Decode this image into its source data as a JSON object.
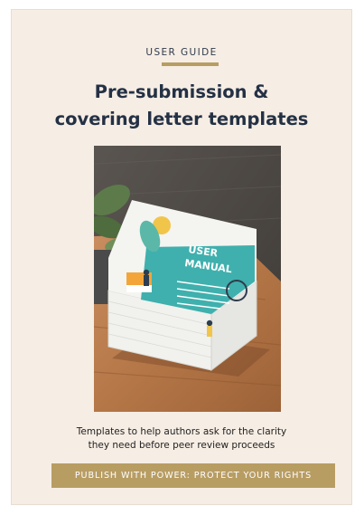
{
  "eyebrow": "USER GUIDE",
  "title": {
    "line1": "Pre-submission &",
    "line2": "covering letter templates"
  },
  "cover": {
    "manual_line1": "USER",
    "manual_line2": "MANUAL",
    "book_color": "#3fb0ad"
  },
  "subtitle": {
    "line1": "Templates to help authors ask for the clarity",
    "line2": "they need before peer review proceeds"
  },
  "banner": "PUBLISH WITH POWER: PROTECT YOUR RIGHTS",
  "colors": {
    "background": "#f6ede4",
    "accent": "#b89d63",
    "title": "#243145"
  }
}
